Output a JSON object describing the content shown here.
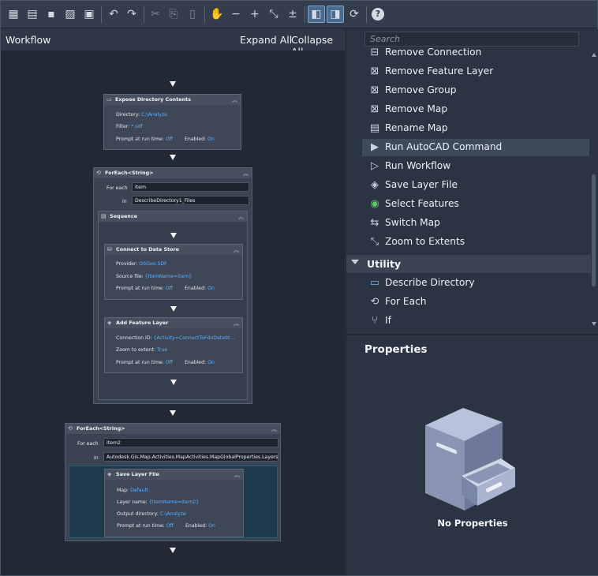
{
  "toolbar": {
    "buttons": [
      {
        "name": "new-workflow-icon",
        "glyph": "▦"
      },
      {
        "name": "open-workflow-icon",
        "glyph": "▤"
      },
      {
        "name": "save-icon",
        "glyph": "▪"
      },
      {
        "name": "save-as-icon",
        "glyph": "▨"
      },
      {
        "name": "save-all-icon",
        "glyph": "▣"
      },
      {
        "name": "undo-icon",
        "glyph": "↶"
      },
      {
        "name": "redo-icon",
        "glyph": "↷"
      },
      {
        "name": "cut-icon",
        "glyph": "✂"
      },
      {
        "name": "copy-icon",
        "glyph": "⎘"
      },
      {
        "name": "paste-icon",
        "glyph": "▯"
      },
      {
        "name": "pan-icon",
        "glyph": "✋"
      },
      {
        "name": "zoom-out-icon",
        "glyph": "−"
      },
      {
        "name": "zoom-in-icon",
        "glyph": "+"
      },
      {
        "name": "zoom-extents-icon",
        "glyph": "⤡"
      },
      {
        "name": "zoom-reset-icon",
        "glyph": "±"
      },
      {
        "name": "layout-toolbox-icon",
        "glyph": "◧"
      },
      {
        "name": "layout-properties-icon",
        "glyph": "◨"
      },
      {
        "name": "refresh-icon",
        "glyph": "⟳"
      },
      {
        "name": "help-icon",
        "glyph": "?"
      }
    ]
  },
  "workflow": {
    "title": "Workflow",
    "expand_all": "Expand All",
    "collapse_all": "Collapse All",
    "expose": {
      "title": "Expose Directory Contents",
      "directory_label": "Directory:",
      "directory_value": "C:\\Analyze",
      "filter_label": "Filter:",
      "filter_value": "*.sdf",
      "prompt_label": "Prompt at run time:",
      "prompt_value": "Off",
      "enabled_label": "Enabled:",
      "enabled_value": "On"
    },
    "foreach1": {
      "title": "ForEach<String>",
      "foreach_label": "For each",
      "foreach_value": "item",
      "in_label": "in",
      "in_value": "DescribeDirectory1_Files",
      "sequence_title": "Sequence",
      "connect": {
        "title": "Connect to Data Store",
        "provider_label": "Provider:",
        "provider_value": "OSGeo.SDF",
        "source_label": "Source file:",
        "source_value": "{ItemName=item}",
        "prompt_label": "Prompt at run time:",
        "prompt_value": "Off",
        "enabled_label": "Enabled:",
        "enabled_value": "On"
      },
      "add_layer": {
        "title": "Add Feature Layer",
        "conn_label": "Connection ID:",
        "conn_value": "{Activity=ConnectToFdoDataSt...",
        "zoom_label": "Zoom to extent:",
        "zoom_value": "True",
        "prompt_label": "Prompt at run time:",
        "prompt_value": "Off",
        "enabled_label": "Enabled:",
        "enabled_value": "On"
      }
    },
    "foreach2": {
      "title": "ForEach<String>",
      "foreach_label": "For each",
      "foreach_value": "item2",
      "in_label": "in",
      "in_value": "Autodesk.Gis.Map.Activities.MapActivities.MapGlobalProperties.Layers",
      "save": {
        "title": "Save Layer File",
        "map_label": "Map:",
        "map_value": "Default",
        "layer_label": "Layer name:",
        "layer_value": "{ItemName=item2}",
        "out_label": "Output directory:",
        "out_value": "C:\\Analyze",
        "prompt_label": "Prompt at run time:",
        "prompt_value": "Off",
        "enabled_label": "Enabled:",
        "enabled_value": "On"
      }
    }
  },
  "toolbox": {
    "search_placeholder": "Search",
    "items": [
      {
        "label": "Remove Connection",
        "icon": "remove-connection-icon",
        "glyph": "⊟"
      },
      {
        "label": "Remove Feature Layer",
        "icon": "remove-feature-layer-icon",
        "glyph": "⊠"
      },
      {
        "label": "Remove Group",
        "icon": "remove-group-icon",
        "glyph": "⊠"
      },
      {
        "label": "Remove Map",
        "icon": "remove-map-icon",
        "glyph": "⊠"
      },
      {
        "label": "Rename Map",
        "icon": "rename-map-icon",
        "glyph": "▤"
      },
      {
        "label": "Run AutoCAD Command",
        "icon": "run-autocad-command-icon",
        "glyph": "▶"
      },
      {
        "label": "Run Workflow",
        "icon": "run-workflow-icon",
        "glyph": "▷"
      },
      {
        "label": "Save Layer File",
        "icon": "save-layer-file-icon",
        "glyph": "◈"
      },
      {
        "label": "Select Features",
        "icon": "select-features-icon",
        "glyph": "◉"
      },
      {
        "label": "Switch Map",
        "icon": "switch-map-icon",
        "glyph": "⇆"
      },
      {
        "label": "Zoom to Extents",
        "icon": "zoom-to-extents-icon",
        "glyph": "⤡"
      }
    ],
    "category": "Utility",
    "utility_items": [
      {
        "label": "Describe Directory",
        "icon": "describe-directory-icon",
        "glyph": "▭"
      },
      {
        "label": "For Each",
        "icon": "for-each-icon",
        "glyph": "⟲"
      },
      {
        "label": "If",
        "icon": "if-icon",
        "glyph": "⑂"
      }
    ]
  },
  "properties": {
    "title": "Properties",
    "empty": "No Properties"
  }
}
